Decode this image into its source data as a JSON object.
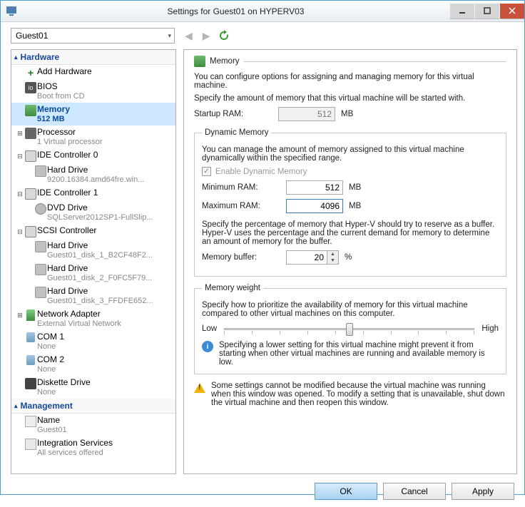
{
  "titlebar": {
    "title": "Settings for Guest01 on HYPERV03"
  },
  "vm_selector": {
    "value": "Guest01"
  },
  "sections": {
    "hardware": "Hardware",
    "management": "Management"
  },
  "tree": {
    "add_hardware": "Add Hardware",
    "bios": {
      "label": "BIOS",
      "sub": "Boot from CD"
    },
    "memory": {
      "label": "Memory",
      "sub": "512 MB"
    },
    "processor": {
      "label": "Processor",
      "sub": "1 Virtual processor"
    },
    "ide0": {
      "label": "IDE Controller 0"
    },
    "ide0_hd": {
      "label": "Hard Drive",
      "sub": "9200.16384.amd64fre.win..."
    },
    "ide1": {
      "label": "IDE Controller 1"
    },
    "ide1_dvd": {
      "label": "DVD Drive",
      "sub": "SQLServer2012SP1-FullSlip..."
    },
    "scsi": {
      "label": "SCSI Controller"
    },
    "scsi_hd1": {
      "label": "Hard Drive",
      "sub": "Guest01_disk_1_B2CF48F2..."
    },
    "scsi_hd2": {
      "label": "Hard Drive",
      "sub": "Guest01_disk_2_F0FC5F79..."
    },
    "scsi_hd3": {
      "label": "Hard Drive",
      "sub": "Guest01_disk_3_FFDFE652..."
    },
    "net": {
      "label": "Network Adapter",
      "sub": "External Virtual Network"
    },
    "com1": {
      "label": "COM 1",
      "sub": "None"
    },
    "com2": {
      "label": "COM 2",
      "sub": "None"
    },
    "floppy": {
      "label": "Diskette Drive",
      "sub": "None"
    },
    "name": {
      "label": "Name",
      "sub": "Guest01"
    },
    "integration": {
      "label": "Integration Services",
      "sub": "All services offered"
    }
  },
  "right": {
    "heading": "Memory",
    "intro": "You can configure options for assigning and managing memory for this virtual machine.",
    "startup_desc": "Specify the amount of memory that this virtual machine will be started with.",
    "startup_label": "Startup RAM:",
    "startup_value": "512",
    "mb": "MB",
    "dyn_legend": "Dynamic Memory",
    "dyn_desc": "You can manage the amount of memory assigned to this virtual machine dynamically within the specified range.",
    "dyn_check": "Enable Dynamic Memory",
    "min_label": "Minimum RAM:",
    "min_value": "512",
    "max_label": "Maximum RAM:",
    "max_value": "4096",
    "buffer_desc": "Specify the percentage of memory that Hyper-V should try to reserve as a buffer. Hyper-V uses the percentage and the current demand for memory to determine an amount of memory for the buffer.",
    "buffer_label": "Memory buffer:",
    "buffer_value": "20",
    "percent": "%",
    "weight_legend": "Memory weight",
    "weight_desc": "Specify how to prioritize the availability of memory for this virtual machine compared to other virtual machines on this computer.",
    "low": "Low",
    "high": "High",
    "info": "Specifying a lower setting for this virtual machine might prevent it from starting when other virtual machines are running and available memory is low.",
    "warn": "Some settings cannot be modified because the virtual machine was running when this window was opened. To modify a setting that is unavailable, shut down the virtual machine and then reopen this window."
  },
  "buttons": {
    "ok": "OK",
    "cancel": "Cancel",
    "apply": "Apply"
  }
}
